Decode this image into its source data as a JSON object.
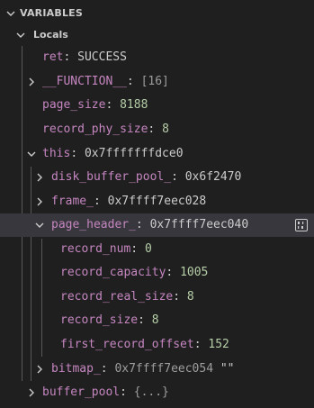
{
  "panel": {
    "title": "VARIABLES"
  },
  "scope": {
    "title": "Locals"
  },
  "rows": [
    {
      "name": "ret",
      "sep": ": ",
      "value": "SUCCESS",
      "value_kind": "plain",
      "state": "leaf"
    },
    {
      "name": "__FUNCTION__",
      "sep": ": ",
      "value": "[16]",
      "value_kind": "dim",
      "state": "collapsed"
    },
    {
      "name": "page_size",
      "sep": ": ",
      "value": "8188",
      "value_kind": "num",
      "state": "leaf"
    },
    {
      "name": "record_phy_size",
      "sep": ": ",
      "value": "8",
      "value_kind": "num",
      "state": "leaf"
    },
    {
      "name": "this",
      "sep": ": ",
      "value": "0x7fffffffdce0",
      "value_kind": "ptr",
      "state": "expanded"
    },
    {
      "name": "disk_buffer_pool_",
      "sep": ": ",
      "value": "0x6f2470",
      "value_kind": "ptr",
      "state": "collapsed"
    },
    {
      "name": "frame_",
      "sep": ": ",
      "value": "0x7ffff7eec028",
      "value_kind": "ptr",
      "state": "collapsed"
    },
    {
      "name": "page_header_",
      "sep": ": ",
      "value": "0x7ffff7eec040",
      "value_kind": "ptr",
      "state": "expanded",
      "selected": true
    },
    {
      "name": "record_num",
      "sep": ": ",
      "value": "0",
      "value_kind": "num",
      "state": "leaf"
    },
    {
      "name": "record_capacity",
      "sep": ": ",
      "value": "1005",
      "value_kind": "num",
      "state": "leaf"
    },
    {
      "name": "record_real_size",
      "sep": ": ",
      "value": "8",
      "value_kind": "num",
      "state": "leaf"
    },
    {
      "name": "record_size",
      "sep": ": ",
      "value": "8",
      "value_kind": "num",
      "state": "leaf"
    },
    {
      "name": "first_record_offset",
      "sep": ": ",
      "value": "152",
      "value_kind": "num",
      "state": "leaf"
    },
    {
      "name": "bitmap_",
      "sep": ": ",
      "value": "0x7ffff7eec054",
      "value_kind": "dim",
      "extra": " \"\"",
      "state": "collapsed"
    },
    {
      "name": "buffer_pool",
      "sep": ": ",
      "value": "{...}",
      "value_kind": "dim",
      "state": "collapsed"
    }
  ],
  "actions": {
    "view_binary_icon": "view-binary-data"
  },
  "colors": {
    "background": "#1f1f1f",
    "name": "#c586c0",
    "number": "#b5cea8",
    "dim": "#9d9d9d",
    "selected_row": "#37373d"
  }
}
